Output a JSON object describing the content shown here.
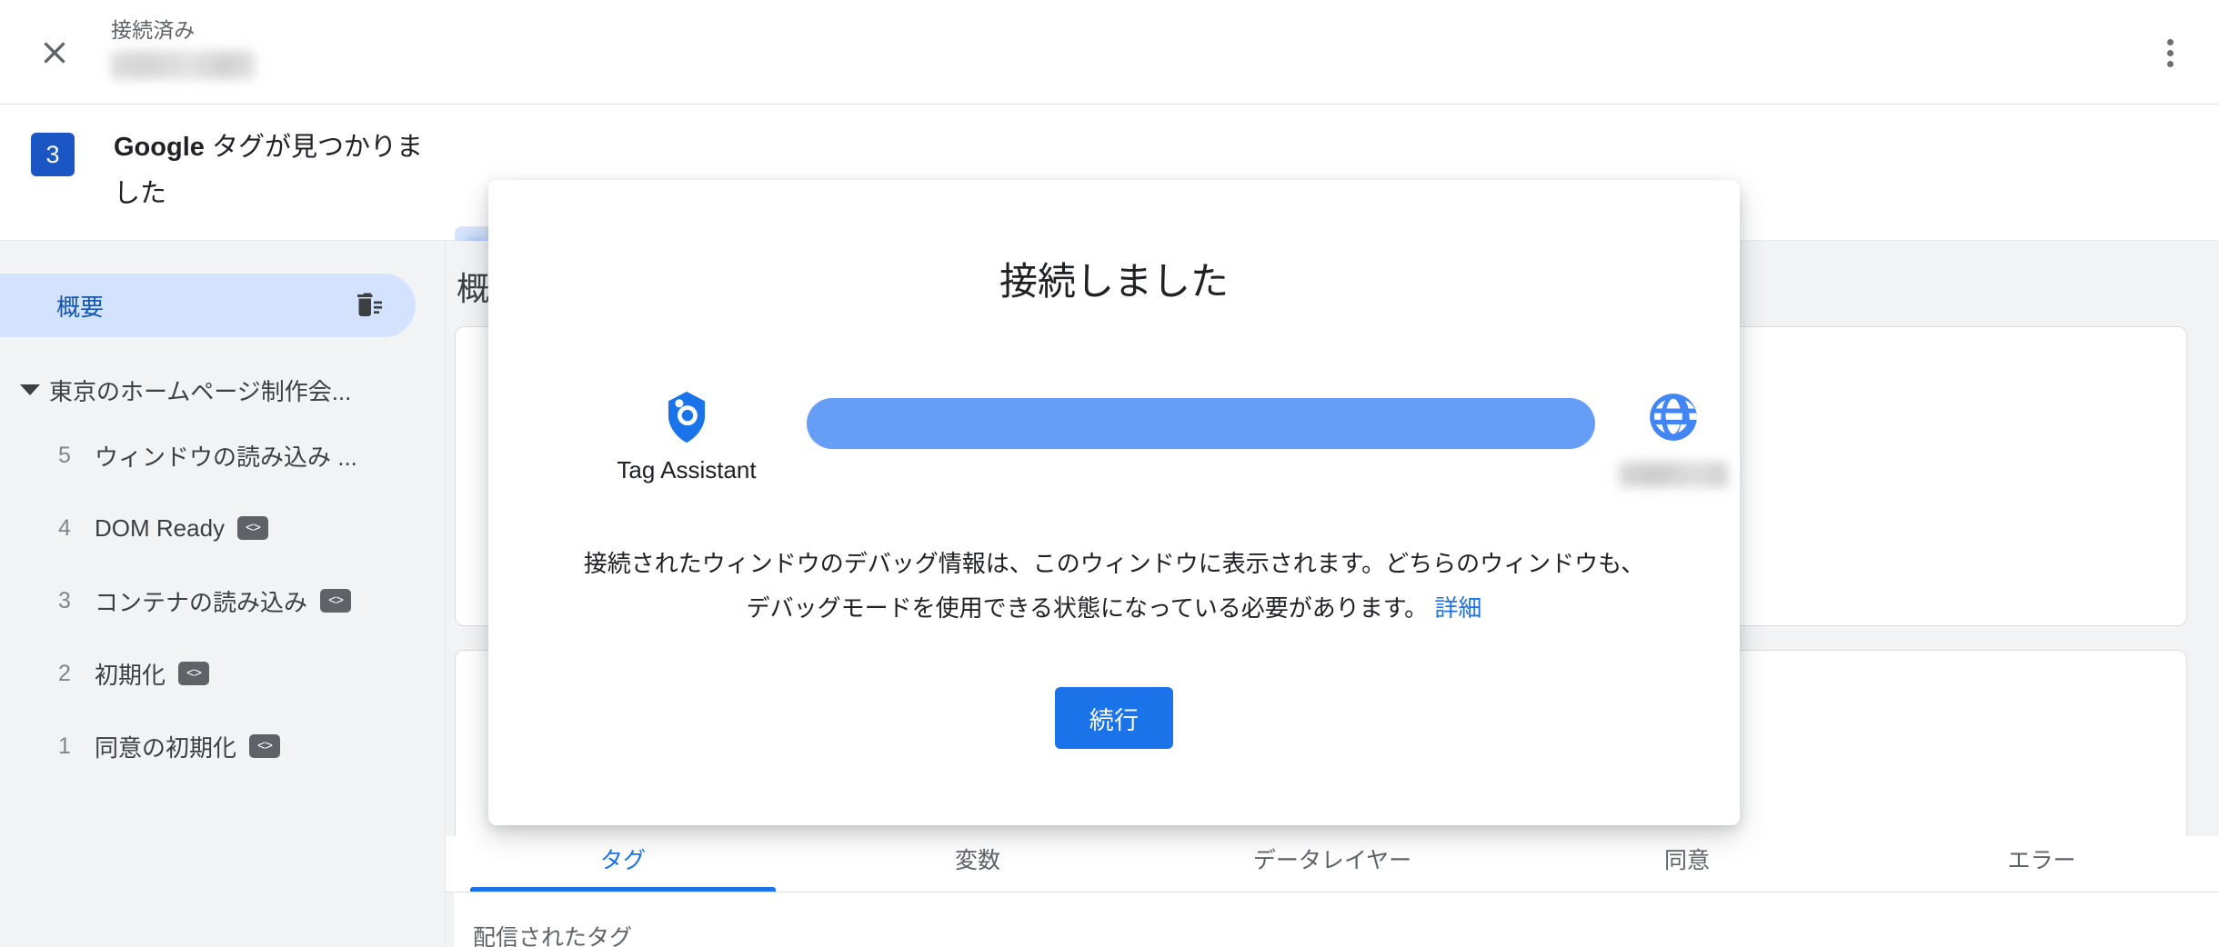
{
  "topbar": {
    "close_icon": "close-icon",
    "connection_status_label": "接続済み",
    "connection_value_redacted": "",
    "overflow_icon": "more-vert-icon"
  },
  "found_bar": {
    "count": "3",
    "title_strong": "Google",
    "title_rest": " タグが見つかりました",
    "chips": [
      {
        "label_redacted": "",
        "selected": true
      },
      {
        "label_redacted": "",
        "selected": false
      },
      {
        "label_redacted": "",
        "selected": false
      }
    ]
  },
  "sidebar": {
    "overview": {
      "label": "概要",
      "trash_icon": "delete-sweep-icon"
    },
    "tree_root": {
      "label": "東京のホームページ制作会...",
      "caret_icon": "caret-down-icon"
    },
    "events": [
      {
        "num": "5",
        "label": "ウィンドウの読み込み ...",
        "code_badge": ""
      },
      {
        "num": "4",
        "label": "DOM Ready",
        "code_badge": "<>"
      },
      {
        "num": "3",
        "label": "コンテナの読み込み",
        "code_badge": "<>"
      },
      {
        "num": "2",
        "label": "初期化",
        "code_badge": "<>"
      },
      {
        "num": "1",
        "label": "同意の初期化",
        "code_badge": "<>"
      }
    ]
  },
  "main": {
    "page_title": "概要",
    "tabs": [
      {
        "label": "タグ",
        "active": true
      },
      {
        "label": "変数",
        "active": false
      },
      {
        "label": "データレイヤー",
        "active": false
      },
      {
        "label": "同意",
        "active": false
      },
      {
        "label": "エラー",
        "active": false
      }
    ],
    "section_label": "配信されたタグ"
  },
  "modal": {
    "title": "接続しました",
    "tag_assistant_label": "Tag Assistant",
    "tag_assistant_icon": "tag-assistant-icon",
    "site_icon": "globe-icon",
    "site_label_redacted": "",
    "body_text": "接続されたウィンドウのデバッグ情報は、このウィンドウに表示されます。どちらのウィンドウも、デバッグモードを使用できる状態になっている必要があります。 ",
    "learn_more_label": "詳細",
    "continue_label": "続行"
  },
  "colors": {
    "accent_blue": "#1a73e8",
    "badge_blue": "#1a56c4",
    "chip_selected_bg": "#d3e3fd",
    "progress_blue": "#669df6",
    "globe_blue": "#4285f4",
    "surface_gray": "#f1f3f4",
    "text_primary": "#202124",
    "text_secondary": "#5f6368"
  }
}
